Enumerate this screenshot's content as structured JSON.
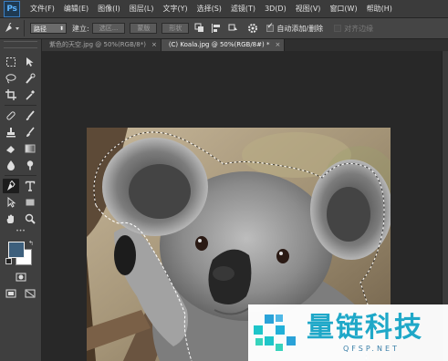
{
  "app": {
    "logo": "Ps"
  },
  "menu": {
    "items": [
      "文件(F)",
      "编辑(E)",
      "图像(I)",
      "图层(L)",
      "文字(Y)",
      "选择(S)",
      "滤镜(T)",
      "3D(D)",
      "视图(V)",
      "窗口(W)",
      "帮助(H)"
    ]
  },
  "options": {
    "mode_value": "路径",
    "make_label": "建立:",
    "selection_button": "选区...",
    "mask_button": "蒙版",
    "shape_button": "形状",
    "auto_add_delete_label": "自动添加/删除",
    "auto_add_delete_checked": true,
    "align_edges_label": "对齐边缘",
    "align_edges_checked": false
  },
  "tabs": [
    {
      "label": "紫色的天空.jpg @ 50%(RGB/8*)",
      "active": false,
      "close": "×"
    },
    {
      "label": "(C) Koala.jpg @ 50%(RGB/8#) *",
      "active": true,
      "close": "×"
    }
  ],
  "colors": {
    "foreground": "#3d5f7c",
    "background": "#ffffff"
  },
  "watermark": {
    "cn_text": "量链科技",
    "url": "QFSP.NET"
  },
  "toolbar_icons": [
    [
      "marquee-icon",
      "move-icon"
    ],
    [
      "lasso-icon",
      "quick-select-icon"
    ],
    [
      "crop-icon",
      "eyedropper-icon"
    ],
    [
      "healing-brush-icon",
      "brush-icon"
    ],
    [
      "clone-stamp-icon",
      "history-brush-icon"
    ],
    [
      "eraser-icon",
      "gradient-icon"
    ],
    [
      "blur-icon",
      "dodge-icon"
    ],
    [
      "pen-icon",
      "type-icon"
    ],
    [
      "path-select-icon",
      "rectangle-icon"
    ],
    [
      "hand-icon",
      "zoom-icon"
    ]
  ]
}
